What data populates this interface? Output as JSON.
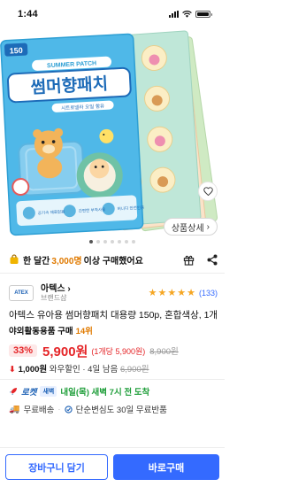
{
  "status": {
    "time": "1:44"
  },
  "hero": {
    "badge": "150",
    "banner": "SUMMER PATCH",
    "headline": "썸머향패치",
    "subtitle": "시트로넬라 오일 함유",
    "feat1": "공기속 재료없음",
    "feat2": "간편한 부착사용",
    "feat3": "허니디 안전인증"
  },
  "detail_button": "상품상세",
  "carousel": {
    "total": 7,
    "active": 0
  },
  "purchase": {
    "prefix": "한 달간",
    "count": "3,000명",
    "suffix": "이상 구매했어요"
  },
  "brand": {
    "logo": "ATEX",
    "name": "아텍스",
    "sub": "브랜드샵",
    "rating_count": "(133)",
    "stars": 5
  },
  "product": {
    "title": "아텍스 유아용 썸머향패치 대용량 150p, 혼합색상, 1개",
    "rank_label": "야외활동용품 구매",
    "rank": "14위"
  },
  "price": {
    "discount": "33%",
    "price": "5,900원",
    "unit_price": "(1개당 5,900원)",
    "original": "8,900원"
  },
  "coupon": {
    "amount": "1,000원",
    "text": "와우할인 · 4일 남음",
    "original": "6,900원"
  },
  "delivery": {
    "rocket": "로켓",
    "dawn": "새벽",
    "arrival": "내일(목) 새벽 7시 전 도착"
  },
  "shipping": {
    "free": "무료배송",
    "returns": "단순변심도 30일 무료반품"
  },
  "actions": {
    "cart": "장바구니 담기",
    "buy": "바로구매"
  },
  "colors": {
    "accent": "#346aff",
    "price": "#e52528",
    "orange": "#e07a00",
    "green": "#1f9e3a"
  }
}
